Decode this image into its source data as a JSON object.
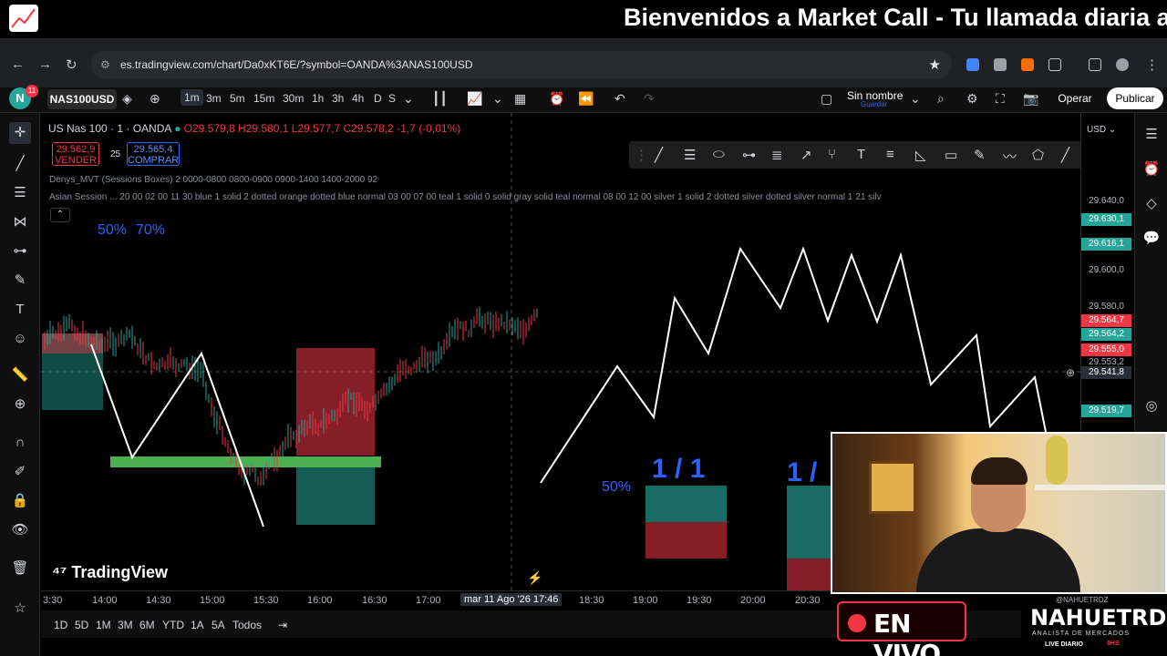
{
  "banner": {
    "title": "Bienvenidos a Market Call - Tu llamada diaria al m"
  },
  "browser": {
    "url": "es.tradingview.com/chart/Da0xKT6E/?symbol=OANDA%3ANAS100USD"
  },
  "toolbar": {
    "notification_count": "11",
    "avatar_letter": "N",
    "symbol": "NAS100USD",
    "timeframes": [
      "1m",
      "3m",
      "5m",
      "15m",
      "30m",
      "1h",
      "3h",
      "4h",
      "D",
      "S"
    ],
    "active_timeframe": "1m",
    "layout_name": "Sin nombre",
    "layout_sub": "Guardar",
    "operar": "Operar",
    "publicar": "Publicar"
  },
  "legend": {
    "symbol_line": "US Nas 100 · 1 · OANDA",
    "ohlc": "O29.579,8 H29.580,1 L29.577,7 C29.578,2 -1,7 (-0,01%)",
    "sell_price": "29.562,9",
    "sell_label": "VENDER",
    "spread": "25",
    "buy_price": "29.565,4",
    "buy_label": "COMPRAR",
    "indicator1": "Denys_MVT (Sessions Boxes) 2 0000-0800 0800-0900 0900-1400 1400-2000 92",
    "indicator2": "Asian Session ...  20 00 02 00 11 30 blue 1 solid 2 dotted orange dotted blue normal 03 00 07 00 teal 1 solid 0 solid gray solid teal normal 08 00 12 00 silver 1 solid 2 dotted silver dotted silver normal 1 21 silv"
  },
  "annotations": {
    "pct50a": "50%",
    "pct70": "70%",
    "pct50b": "50%",
    "ratio1": "1 / 1",
    "ratio2": "1 /"
  },
  "tv_logo": "TradingView",
  "price_scale": {
    "currency": "USD",
    "labels": [
      {
        "text": "29.640,0",
        "kind": "tick"
      },
      {
        "text": "29.630,1",
        "kind": "teal"
      },
      {
        "text": "29.616,1",
        "kind": "teal"
      },
      {
        "text": "29.600,0",
        "kind": "tick"
      },
      {
        "text": "29.580,0",
        "kind": "tick"
      },
      {
        "text": "29.564,7",
        "kind": "red"
      },
      {
        "text": "29.564,2",
        "kind": "teal"
      },
      {
        "text": "29.555,0",
        "kind": "red"
      },
      {
        "text": "29.553,2",
        "kind": "tick"
      },
      {
        "text": "29.541,8",
        "kind": "crosshair"
      },
      {
        "text": "29.519,7",
        "kind": "teal"
      }
    ]
  },
  "time_axis": {
    "labels": [
      "3:30",
      "14:00",
      "14:30",
      "15:00",
      "15:30",
      "16:00",
      "16:30",
      "17:00",
      "mar 11 Ago '26",
      "17:46",
      "18:30",
      "19:00",
      "19:30",
      "20:00",
      "20:30"
    ],
    "active": "mar 11 Ago '26  17:46"
  },
  "ranges": [
    "1D",
    "5D",
    "1M",
    "3M",
    "6M",
    "YTD",
    "1A",
    "5A",
    "Todos"
  ],
  "live": {
    "label": "EN VIVO"
  },
  "channel": {
    "handle": "@NAHUETRDZ",
    "name": "NAHUETRDZ",
    "role": "ANALISTA DE MERCADOS",
    "live_diario": "LIVE DIARIO",
    "hours": "9HS"
  },
  "colors": {
    "bull": "#26a69a",
    "bear": "#f23645",
    "accent": "#2962ff",
    "zone_green": "#4caf50"
  }
}
